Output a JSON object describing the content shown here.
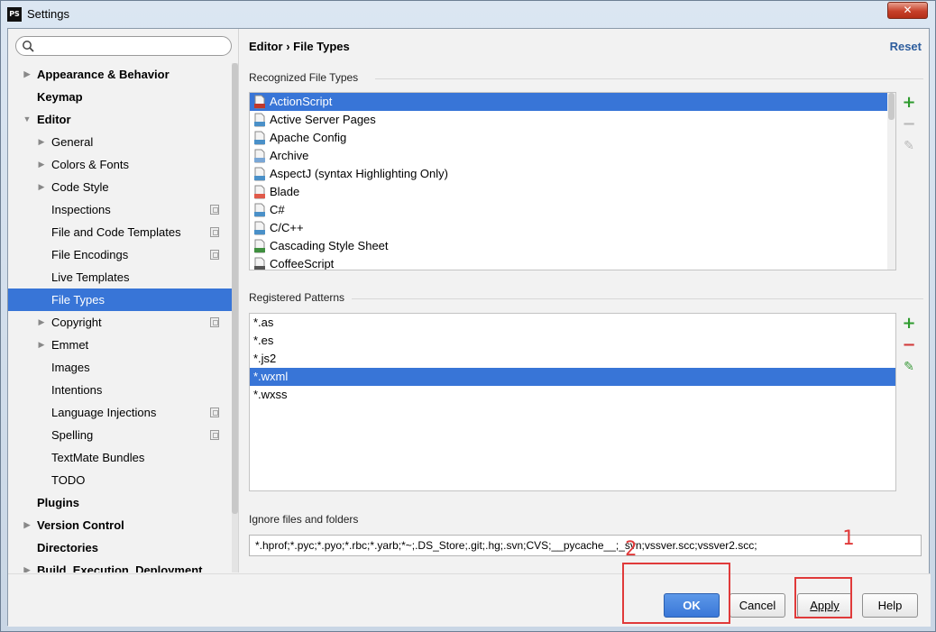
{
  "window": {
    "title": "Settings",
    "app_icon": "PS",
    "close": "✕"
  },
  "sidebar": {
    "search": {
      "placeholder": ""
    },
    "items": [
      {
        "label": "Appearance & Behavior",
        "level": 0,
        "bold": true,
        "arrow": "right"
      },
      {
        "label": "Keymap",
        "level": 0,
        "bold": true,
        "arrow": ""
      },
      {
        "label": "Editor",
        "level": 0,
        "bold": true,
        "arrow": "down"
      },
      {
        "label": "General",
        "level": 1,
        "bold": false,
        "arrow": "right"
      },
      {
        "label": "Colors & Fonts",
        "level": 1,
        "bold": false,
        "arrow": "right"
      },
      {
        "label": "Code Style",
        "level": 1,
        "bold": false,
        "arrow": "right"
      },
      {
        "label": "Inspections",
        "level": 1,
        "bold": false,
        "arrow": "",
        "project_icon": true
      },
      {
        "label": "File and Code Templates",
        "level": 1,
        "bold": false,
        "arrow": "",
        "project_icon": true
      },
      {
        "label": "File Encodings",
        "level": 1,
        "bold": false,
        "arrow": "",
        "project_icon": true
      },
      {
        "label": "Live Templates",
        "level": 1,
        "bold": false,
        "arrow": ""
      },
      {
        "label": "File Types",
        "level": 1,
        "bold": false,
        "arrow": "",
        "selected": true
      },
      {
        "label": "Copyright",
        "level": 1,
        "bold": false,
        "arrow": "right",
        "project_icon": true
      },
      {
        "label": "Emmet",
        "level": 1,
        "bold": false,
        "arrow": "right"
      },
      {
        "label": "Images",
        "level": 1,
        "bold": false,
        "arrow": ""
      },
      {
        "label": "Intentions",
        "level": 1,
        "bold": false,
        "arrow": ""
      },
      {
        "label": "Language Injections",
        "level": 1,
        "bold": false,
        "arrow": "",
        "project_icon": true
      },
      {
        "label": "Spelling",
        "level": 1,
        "bold": false,
        "arrow": "",
        "project_icon": true
      },
      {
        "label": "TextMate Bundles",
        "level": 1,
        "bold": false,
        "arrow": ""
      },
      {
        "label": "TODO",
        "level": 1,
        "bold": false,
        "arrow": ""
      },
      {
        "label": "Plugins",
        "level": 0,
        "bold": true,
        "arrow": ""
      },
      {
        "label": "Version Control",
        "level": 0,
        "bold": true,
        "arrow": "right"
      },
      {
        "label": "Directories",
        "level": 0,
        "bold": true,
        "arrow": ""
      },
      {
        "label": "Build, Execution, Deployment",
        "level": 0,
        "bold": true,
        "arrow": "right"
      }
    ]
  },
  "header": {
    "breadcrumb_parent": "Editor",
    "breadcrumb_sep": "›",
    "breadcrumb_current": "File Types",
    "reset_label": "Reset"
  },
  "recognized": {
    "title": "Recognized File Types",
    "items": [
      {
        "label": "ActionScript",
        "icon": "actionscript-icon",
        "color": "#c0392b",
        "selected": true
      },
      {
        "label": "Active Server Pages",
        "icon": "unknown-file-icon",
        "color": "#4a90c8"
      },
      {
        "label": "Apache Config",
        "icon": "unknown-file-icon",
        "color": "#4a90c8"
      },
      {
        "label": "Archive",
        "icon": "archive-icon",
        "color": "#7aa7d6"
      },
      {
        "label": "AspectJ (syntax Highlighting Only)",
        "icon": "unknown-file-icon",
        "color": "#4a90c8"
      },
      {
        "label": "Blade",
        "icon": "blade-icon",
        "color": "#e05a4a"
      },
      {
        "label": "C#",
        "icon": "unknown-file-icon",
        "color": "#4a90c8"
      },
      {
        "label": "C/C++",
        "icon": "unknown-file-icon",
        "color": "#4a90c8"
      },
      {
        "label": "Cascading Style Sheet",
        "icon": "css-icon",
        "color": "#3f8f3f"
      },
      {
        "label": "CoffeeScript",
        "icon": "coffeescript-icon",
        "color": "#555555"
      }
    ],
    "tools": {
      "add": "+",
      "remove": "−",
      "edit": "✎"
    }
  },
  "patterns": {
    "title": "Registered Patterns",
    "items": [
      {
        "label": "*.as"
      },
      {
        "label": "*.es"
      },
      {
        "label": "*.js2"
      },
      {
        "label": "*.wxml",
        "selected": true
      },
      {
        "label": "*.wxss"
      }
    ],
    "tools": {
      "add": "+",
      "remove": "−",
      "edit": "✎"
    }
  },
  "ignore": {
    "title": "Ignore files and folders",
    "value": "*.hprof;*.pyc;*.pyo;*.rbc;*.yarb;*~;.DS_Store;.git;.hg;.svn;CVS;__pycache__;_svn;vssver.scc;vssver2.scc;"
  },
  "footer": {
    "ok": "OK",
    "cancel": "Cancel",
    "apply": "Apply",
    "help": "Help"
  },
  "annotations": {
    "one": "1",
    "two": "2"
  },
  "colors": {
    "selection": "#3875d7",
    "accent_link": "#2e5e9e",
    "add_green": "#2e9b2e",
    "remove_red": "#d23b3b",
    "annotation": "#e03a3a"
  }
}
